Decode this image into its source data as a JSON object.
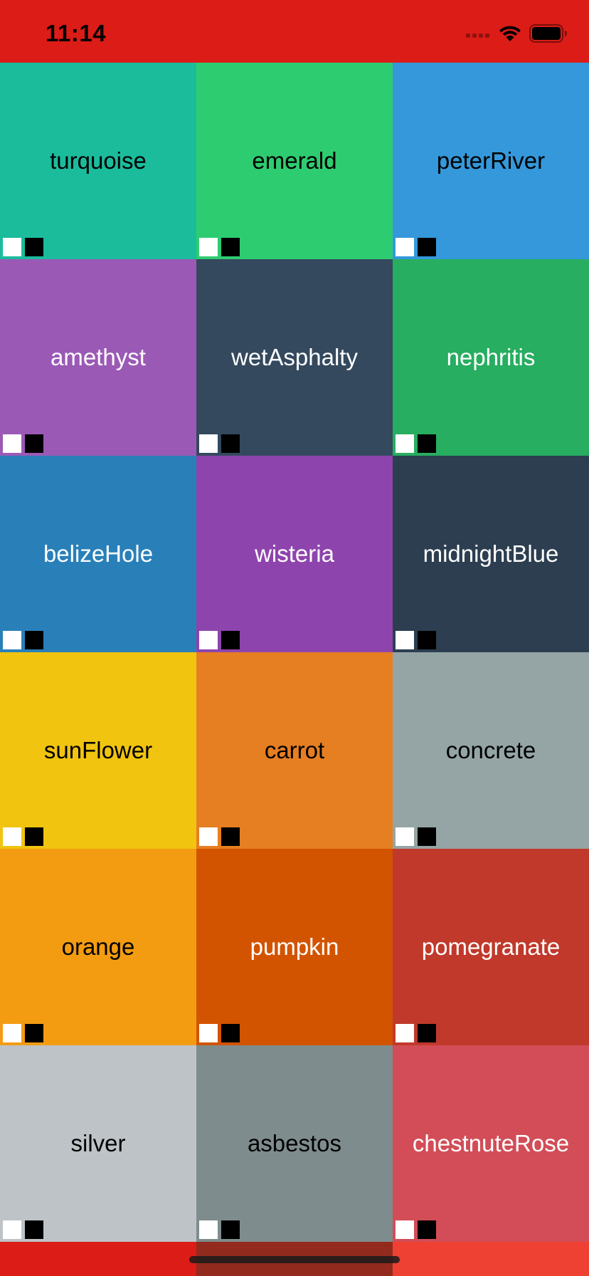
{
  "status_bar": {
    "time": "11:14",
    "background": "#dc1c17",
    "icons": [
      "signal-dots-icon",
      "wifi-icon",
      "battery-icon"
    ]
  },
  "tiles": [
    {
      "label": "turquoise",
      "color": "#1abc9c",
      "text_color": "#000000"
    },
    {
      "label": "emerald",
      "color": "#2ecc71",
      "text_color": "#000000"
    },
    {
      "label": "peterRiver",
      "color": "#3498db",
      "text_color": "#000000"
    },
    {
      "label": "amethyst",
      "color": "#9b59b6",
      "text_color": "#ffffff"
    },
    {
      "label": "wetAsphalty",
      "color": "#34495e",
      "text_color": "#ffffff"
    },
    {
      "label": "nephritis",
      "color": "#27ae60",
      "text_color": "#ffffff"
    },
    {
      "label": "belizeHole",
      "color": "#2980b9",
      "text_color": "#ffffff"
    },
    {
      "label": "wisteria",
      "color": "#8e44ad",
      "text_color": "#ffffff"
    },
    {
      "label": "midnightBlue",
      "color": "#2c3e50",
      "text_color": "#ffffff"
    },
    {
      "label": "sunFlower",
      "color": "#f1c40f",
      "text_color": "#000000"
    },
    {
      "label": "carrot",
      "color": "#e67e22",
      "text_color": "#000000"
    },
    {
      "label": "concrete",
      "color": "#95a5a6",
      "text_color": "#000000"
    },
    {
      "label": "orange",
      "color": "#f39c12",
      "text_color": "#000000"
    },
    {
      "label": "pumpkin",
      "color": "#d35400",
      "text_color": "#ffffff"
    },
    {
      "label": "pomegranate",
      "color": "#c0392b",
      "text_color": "#ffffff"
    },
    {
      "label": "silver",
      "color": "#bdc3c7",
      "text_color": "#000000"
    },
    {
      "label": "asbestos",
      "color": "#7f8c8d",
      "text_color": "#000000"
    },
    {
      "label": "chestnuteRose",
      "color": "#d24d57",
      "text_color": "#ffffff"
    }
  ],
  "bottom_bar_colors": [
    "#dc1c17",
    "#922a1e",
    "#ee4133"
  ]
}
